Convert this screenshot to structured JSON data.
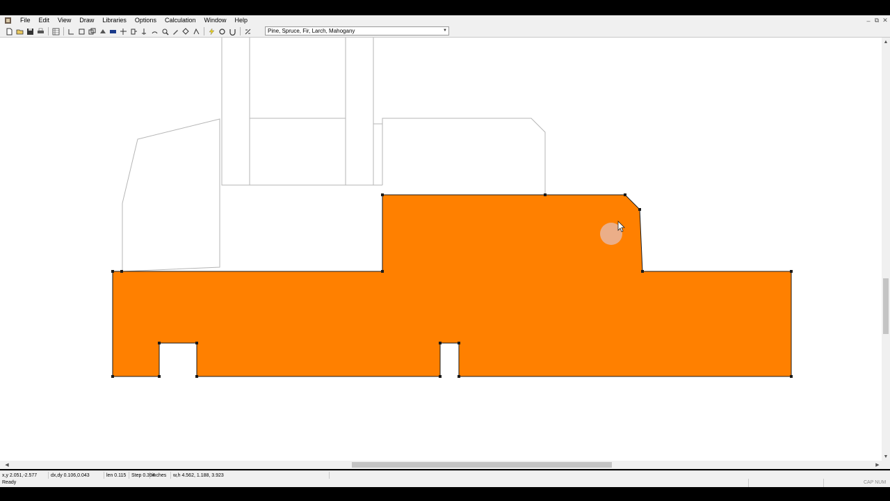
{
  "menu": {
    "items": [
      "File",
      "Edit",
      "View",
      "Draw",
      "Libraries",
      "Options",
      "Calculation",
      "Window",
      "Help"
    ]
  },
  "toolbar": {
    "icons": [
      "new-icon",
      "open-icon",
      "save-icon",
      "print-icon",
      "table-icon",
      "polyline-icon",
      "rectangle-icon",
      "copy-icon",
      "fill-icon",
      "pointer-icon",
      "split-icon",
      "move-icon",
      "arc-icon",
      "zoom-icon",
      "pen-icon",
      "erase-icon",
      "node-icon",
      "calculate-icon",
      "settings-icon",
      "text-icon",
      "formula-icon"
    ],
    "material_select": "Pine, Spruce, Fir, Larch, Mahogany"
  },
  "colors": {
    "fill": "#FF8000",
    "outline": "#1a1a1a",
    "ghost_outline": "#b5b5b5",
    "cursor_highlight": "#e8b6a0"
  },
  "coordbar": {
    "xy": "x,y 2.051,-2.577",
    "dxdy": "dx,dy 0.106,0.043",
    "len": "len 0.115",
    "step": "Step 0.394",
    "units": "inches",
    "wh": "w,h 4.562, 1.188,  3.923"
  },
  "status": {
    "ready": "Ready",
    "indicators": "CAP  NUM"
  }
}
